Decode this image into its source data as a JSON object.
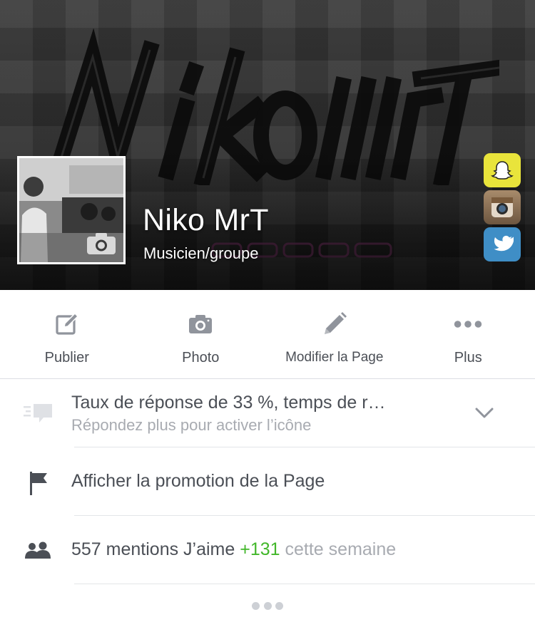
{
  "cover": {
    "social_icons": [
      "snapchat-icon",
      "instagram-icon",
      "twitter-icon"
    ]
  },
  "page": {
    "name": "Niko MrT",
    "category": "Musicien/groupe"
  },
  "actions": [
    {
      "label": "Publier",
      "icon": "edit-icon"
    },
    {
      "label": "Photo",
      "icon": "camera-icon"
    },
    {
      "label": "Modifier la Page",
      "icon": "pencil-icon"
    },
    {
      "label": "Plus",
      "icon": "more-icon"
    }
  ],
  "response": {
    "title": "Taux de réponse de 33 %, temps de r…",
    "subtitle": "Répondez plus pour activer l’icône",
    "icon": "message-icon"
  },
  "promotion": {
    "label": "Afficher la promotion de la Page",
    "icon": "flag-icon"
  },
  "likes": {
    "count_text": "557 mentions J’aime",
    "gain_text": "+131",
    "period_text": "cette semaine",
    "icon": "people-icon"
  },
  "colors": {
    "text_primary": "#4b4f56",
    "text_secondary": "#a8abb1",
    "icon_gray": "#90949c",
    "positive": "#42b72a",
    "divider": "#e3e5e8"
  }
}
